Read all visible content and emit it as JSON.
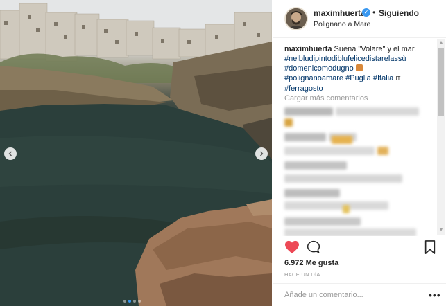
{
  "post": {
    "username": "maximhuerta",
    "verified_icon": "verified-badge-icon",
    "separator": "•",
    "follow_status": "Siguiendo",
    "location": "Polignano a Mare"
  },
  "caption": {
    "username": "maximhuerta",
    "text": "Suena \"Volare\" y el mar.",
    "tags": [
      "#nelbludipintodiblufelicedistarelassù",
      "#domenicomodugno",
      "#polignanoamare",
      "#Puglia",
      "#Italia",
      "#ferragosto"
    ],
    "emoji_guitar": "guitar-emoji-icon",
    "flag_text": "IT"
  },
  "comments": {
    "load_more": "Cargar más comentarios"
  },
  "stats": {
    "likes": "6.972 Me gusta",
    "time_ago": "HACE UN DÍA"
  },
  "composer": {
    "placeholder": "Añade un comentario...",
    "more_label": "•••"
  },
  "carousel": {
    "slide_count": 4,
    "active_index": 1
  },
  "colors": {
    "like_red": "#ed4956",
    "verified_blue": "#3897f0",
    "hashtag_blue": "#003569",
    "muted_gray": "#999999"
  }
}
